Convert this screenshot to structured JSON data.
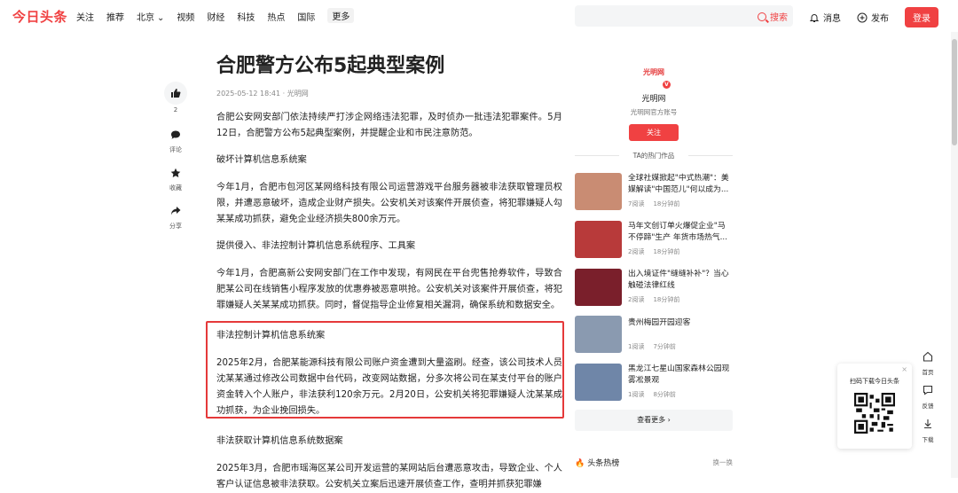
{
  "header": {
    "logo": "今日头条",
    "nav": [
      "关注",
      "推荐",
      "北京",
      "视频",
      "财经",
      "科技",
      "热点",
      "国际"
    ],
    "nav_more": "更多",
    "city_chevron": "⌄",
    "search_label": "搜索",
    "search_placeholder": "",
    "messages_label": "消息",
    "publish_label": "发布",
    "login_label": "登录"
  },
  "actions": {
    "like_count": "2",
    "comment_label": "评论",
    "favorite_label": "收藏",
    "share_label": "分享"
  },
  "article": {
    "title": "合肥警方公布5起典型案例",
    "meta": "2025-05-12 18:41 · 光明网",
    "intro": "合肥公安网安部门依法持续严打涉企网络违法犯罪，及时侦办一批违法犯罪案件。5月12日，合肥警方公布5起典型案例，并提醒企业和市民注意防范。",
    "s1_title": "破坏计算机信息系统案",
    "s1_body": "今年1月，合肥市包河区某网络科技有限公司运营游戏平台服务器被非法获取管理员权限，并遭恶意破坏，造成企业财产损失。公安机关对该案件开展侦查，将犯罪嫌疑人勾某某成功抓获，避免企业经济损失800余万元。",
    "s2_title": "提供侵入、非法控制计算机信息系统程序、工具案",
    "s2_body": "今年1月，合肥高新公安网安部门在工作中发现，有网民在平台兜售抢券软件，导致合肥某公司在线销售小程序发放的优惠券被恶意哄抢。公安机关对该案件开展侦查，将犯罪嫌疑人关某某成功抓获。同时，督促指导企业修复相关漏洞，确保系统和数据安全。",
    "s3_title": "非法控制计算机信息系统案",
    "s3_body": "2025年2月，合肥某能源科技有限公司账户资金遭到大量盗刷。经查，该公司技术人员沈某某通过修改公司数据中台代码，改变网站数据，分多次将公司在某支付平台的账户资金转入个人账户，非法获利120余万元。2月20日，公安机关将犯罪嫌疑人沈某某成功抓获，为企业挽回损失。",
    "s4_title": "非法获取计算机信息系统数据案",
    "s4_body": "2025年3月，合肥市瑶海区某公司开发运营的某网站后台遭恶意攻击，导致企业、个人客户认证信息被非法获取。公安机关立案后迅速开展侦查工作，查明并抓获犯罪嫌"
  },
  "author": {
    "logo_text": "光明网",
    "name": "光明网",
    "desc": "光明网官方账号",
    "follow_label": "关注",
    "verified": "V"
  },
  "works": {
    "heading": "TA的热门作品",
    "items": [
      {
        "title": "全球社媒掀起\"中式热潮\"：美媒解读\"中国范儿\"何以成为...",
        "reads": "7阅读",
        "time": "18分钟前",
        "color": "#c98c73"
      },
      {
        "title": "马年文创订单火爆促企业\"马不停蹄\"生产 年货市场热气...",
        "reads": "2阅读",
        "time": "18分钟前",
        "color": "#b83a3a"
      },
      {
        "title": "出入境证件\"缝缝补补\"？当心触碰法律红线",
        "reads": "2阅读",
        "time": "18分钟前",
        "color": "#7a1f2b"
      },
      {
        "title": "贵州梅园开园迎客",
        "reads": "1阅读",
        "time": "7分钟前",
        "color": "#8a9ab0"
      },
      {
        "title": "黑龙江七星山国家森林公园现雾凇景观",
        "reads": "1阅读",
        "time": "8分钟前",
        "color": "#6f86a8"
      }
    ],
    "see_more": "查看更多 ›"
  },
  "hot": {
    "title": "头条热榜",
    "refresh": "换一换"
  },
  "sidebar_float": {
    "qr_title": "扫码下载今日头条",
    "close": "×",
    "home": "首页",
    "feedback": "反馈",
    "download": "下载"
  }
}
